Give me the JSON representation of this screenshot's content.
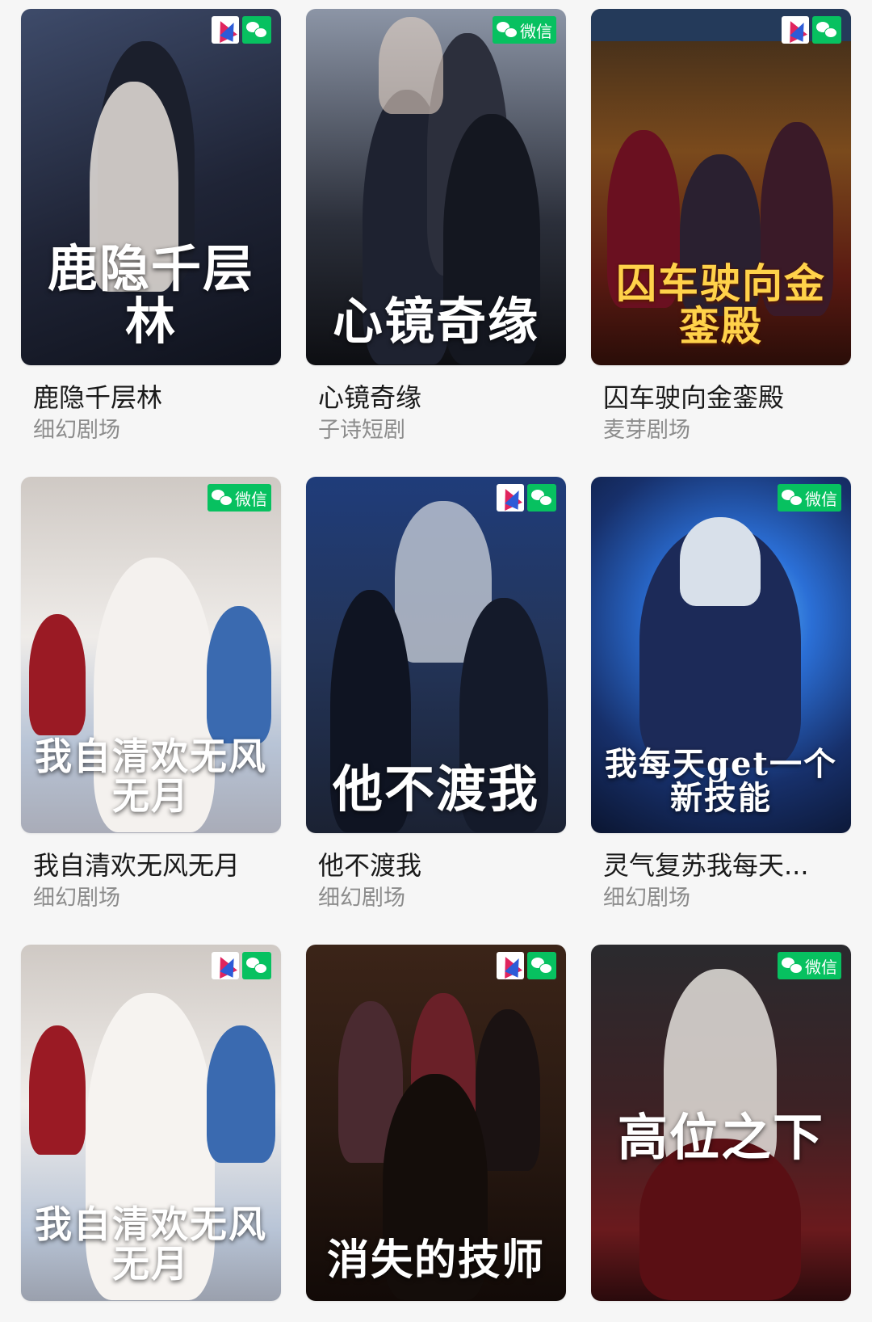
{
  "badges": {
    "wechat_label": "微信"
  },
  "cards": [
    {
      "title": "鹿隐千层林",
      "source": "细幻剧场",
      "poster_text": "鹿隐千层林",
      "show_app_badge": true,
      "show_wechat_label": false
    },
    {
      "title": "心镜奇缘",
      "source": "子诗短剧",
      "poster_text": "心镜奇缘",
      "show_app_badge": false,
      "show_wechat_label": true
    },
    {
      "title": "囚车驶向金銮殿",
      "source": "麦芽剧场",
      "poster_text": "囚车驶向金銮殿",
      "show_app_badge": true,
      "show_wechat_label": false
    },
    {
      "title": "我自清欢无风无月",
      "source": "细幻剧场",
      "poster_text": "我自清欢无风无月",
      "show_app_badge": false,
      "show_wechat_label": true
    },
    {
      "title": "他不渡我",
      "source": "细幻剧场",
      "poster_text": "他不渡我",
      "show_app_badge": true,
      "show_wechat_label": false
    },
    {
      "title": "灵气复苏我每天...",
      "source": "细幻剧场",
      "poster_text": "我每天get一个新技能",
      "show_app_badge": false,
      "show_wechat_label": true
    },
    {
      "title": "",
      "source": "",
      "poster_text": "我自清欢无风无月",
      "show_app_badge": true,
      "show_wechat_label": false
    },
    {
      "title": "",
      "source": "",
      "poster_text": "消失的技师",
      "show_app_badge": true,
      "show_wechat_label": false
    },
    {
      "title": "",
      "source": "",
      "poster_text": "高位之下",
      "show_app_badge": false,
      "show_wechat_label": true
    }
  ],
  "colors": {
    "wechat_green": "#07c160",
    "title_text": "#1a1a1a",
    "subtitle_text": "#8c8c8c",
    "background": "#f6f6f6"
  }
}
